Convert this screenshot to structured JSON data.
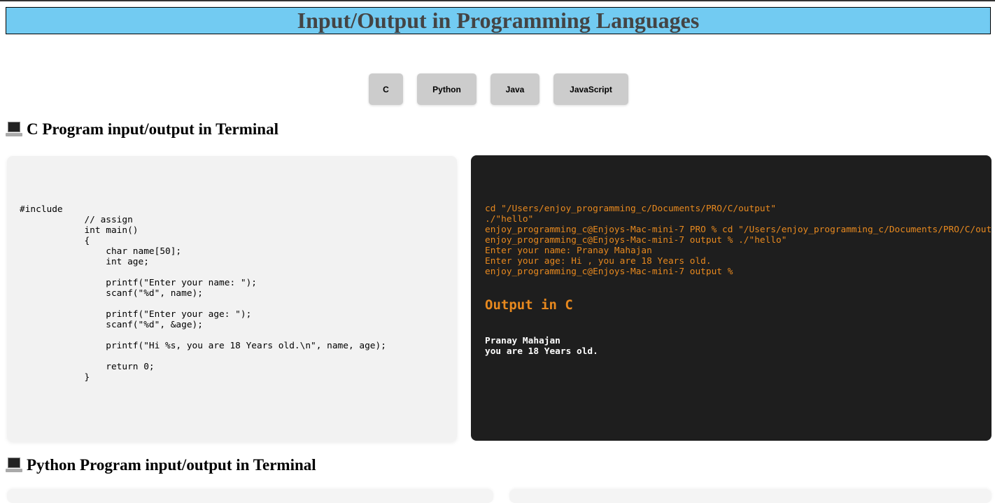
{
  "header": {
    "title": "Input/Output in Programming Languages"
  },
  "language_buttons": [
    {
      "label": "C"
    },
    {
      "label": "Python"
    },
    {
      "label": "Java"
    },
    {
      "label": "JavaScript"
    }
  ],
  "sections": [
    {
      "icon": "laptop-icon",
      "heading": "C Program input/output in Terminal",
      "code": "#include\n            // assign\n            int main()\n            {\n                char name[50];\n                int age;\n\n                printf(\"Enter your name: \");\n                scanf(\"%d\", name);\n\n                printf(\"Enter your age: \");\n                scanf(\"%d\", &age);\n\n                printf(\"Hi %s, you are 18 Years old.\\n\", name, age);\n\n                return 0;\n            }",
      "terminal": "cd \"/Users/enjoy_programming_c/Documents/PRO/C/output\"\n./\"hello\"\nenjoy_programming_c@Enjoys-Mac-mini-7 PRO % cd \"/Users/enjoy_programming_c/Documents/PRO/C/output\"\nenjoy_programming_c@Enjoys-Mac-mini-7 output % ./\"hello\"\nEnter your name: Pranay Mahajan\nEnter your age: Hi , you are 18 Years old.\nenjoy_programming_c@Enjoys-Mac-mini-7 output %",
      "output_heading": "Output in C",
      "output": "Pranay Mahajan\nyou are 18 Years old."
    },
    {
      "icon": "laptop-icon",
      "heading": "Python Program input/output in Terminal"
    }
  ],
  "colors": {
    "title_bg": "#72cbf2",
    "terminal_bg": "#1e1e1e",
    "terminal_text": "#e8891e",
    "button_bg": "#cccccc"
  }
}
